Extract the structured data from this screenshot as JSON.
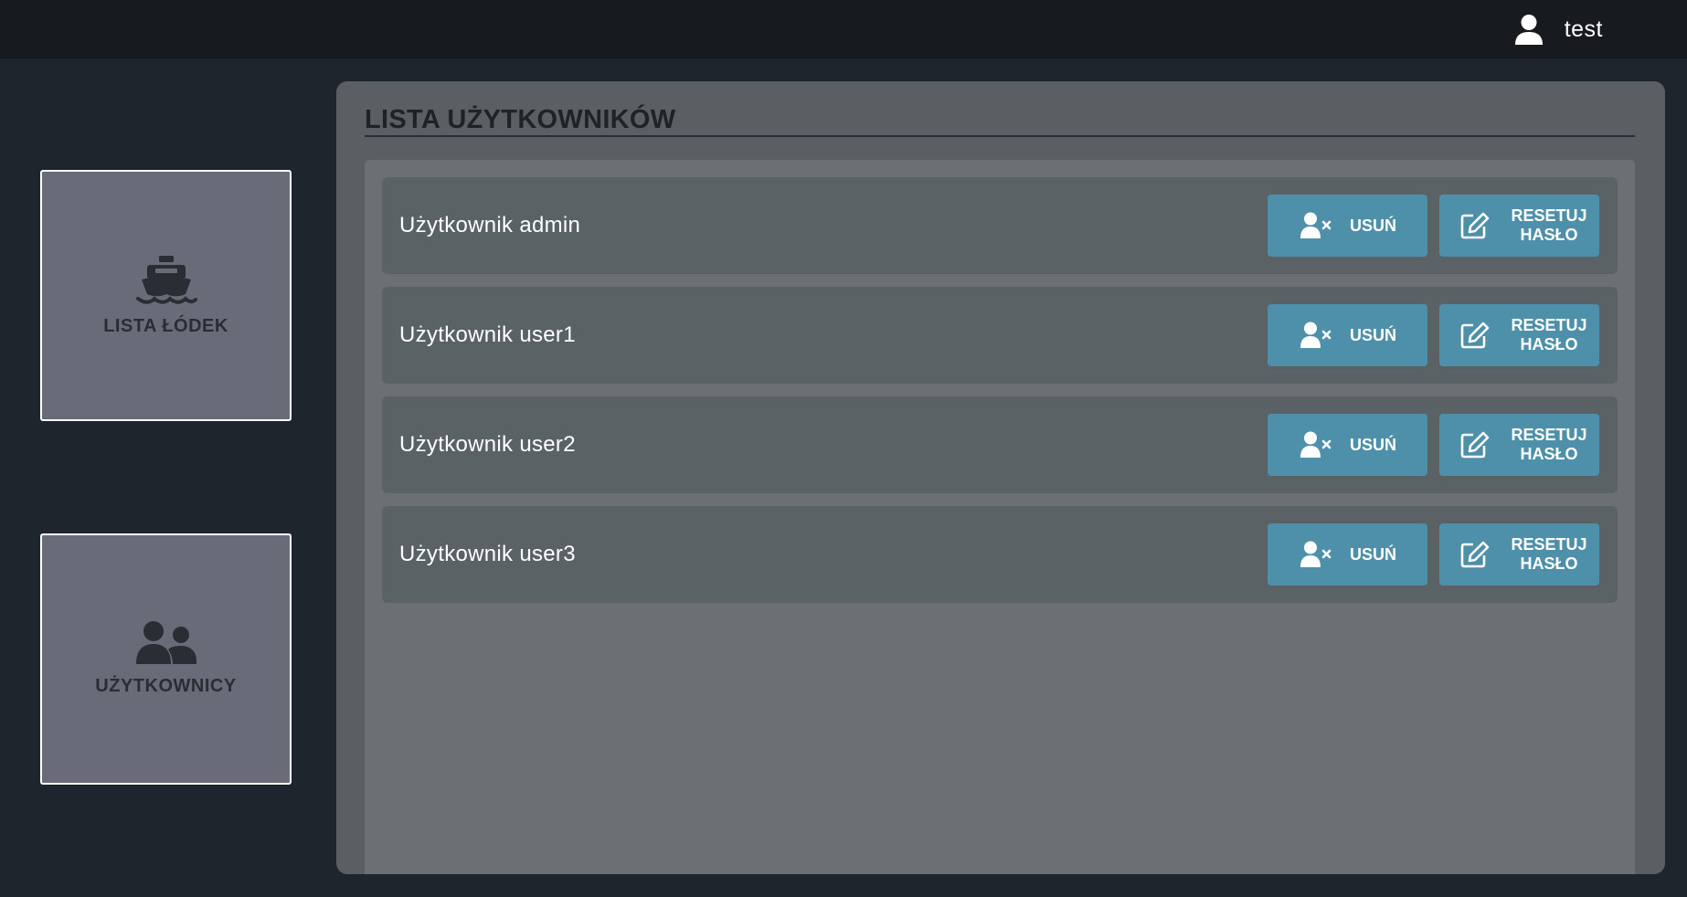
{
  "header": {
    "username": "test"
  },
  "sidebar": {
    "tiles": [
      {
        "label": "LISTA ŁÓDEK",
        "icon": "ship-icon"
      },
      {
        "label": "UŻYTKOWNICY",
        "icon": "users-icon"
      }
    ]
  },
  "main": {
    "title": "LISTA UŻYTKOWNIKÓW",
    "users": [
      {
        "label": "Użytkownik admin"
      },
      {
        "label": "Użytkownik user1"
      },
      {
        "label": "Użytkownik user2"
      },
      {
        "label": "Użytkownik user3"
      }
    ],
    "delete_label": "USUŃ",
    "reset_label_line1": "RESETUJ",
    "reset_label_line2": "HASŁO"
  },
  "colors": {
    "accent_button": "#4e8faa",
    "tile_bg": "#696b79",
    "topbar_bg": "#171b20",
    "page_bg": "#1f252c"
  }
}
